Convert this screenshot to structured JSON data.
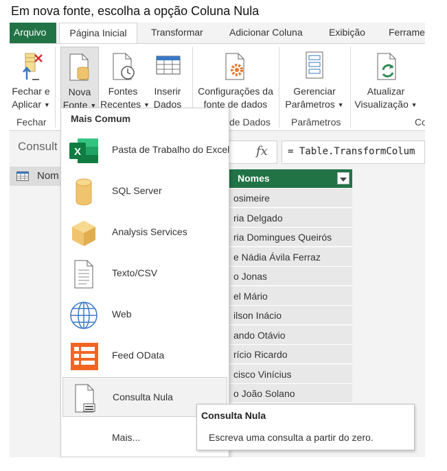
{
  "caption": "Em nova fonte, escolha a opção Coluna Nula",
  "tabs": {
    "arquivo": "Arquivo",
    "pagina_inicial": "Página Inicial",
    "transformar": "Transformar",
    "adicionar_coluna": "Adicionar Coluna",
    "exibicao": "Exibição",
    "ferramentas": "Ferrame"
  },
  "ribbon": {
    "fechar_aplicar": [
      "Fechar e",
      "Aplicar"
    ],
    "nova_fonte": [
      "Nova",
      "Fonte"
    ],
    "fontes_recentes": [
      "Fontes",
      "Recentes"
    ],
    "inserir_dados": [
      "Inserir",
      "Dados"
    ],
    "configuracoes": [
      "Configurações da",
      "fonte de dados"
    ],
    "gerenciar": [
      "Gerenciar",
      "Parâmetros"
    ],
    "atualizar": [
      "Atualizar",
      "Visualização"
    ],
    "groups": {
      "fechar": "Fechar",
      "dados": "de Dados",
      "parametros": "Parâmetros",
      "co": "Co"
    }
  },
  "left_pane": {
    "title": "Consult",
    "query_name": "Nom"
  },
  "formula": {
    "fx": "fx",
    "text": "= Table.TransformColum"
  },
  "grid": {
    "column_header": "Nomes",
    "rows": [
      "osimeire",
      "ria Delgado",
      "ria Domingues Queirós",
      "e Nádia Ávila Ferraz",
      "o Jonas",
      "el Mário",
      "ilson Inácio",
      "ando Otávio",
      "rício Ricardo",
      "cisco Vinícius",
      "o João Solano"
    ]
  },
  "dropdown": {
    "header": "Mais Comum",
    "items": [
      {
        "label": "Pasta de Trabalho do Excel",
        "icon": "excel-icon"
      },
      {
        "label": "SQL Server",
        "icon": "database-icon"
      },
      {
        "label": "Analysis Services",
        "icon": "cube-icon"
      },
      {
        "label": "Texto/CSV",
        "icon": "document-icon"
      },
      {
        "label": "Web",
        "icon": "globe-icon"
      },
      {
        "label": "Feed OData",
        "icon": "odata-icon"
      },
      {
        "label": "Consulta Nula",
        "icon": "blank-query-icon"
      },
      {
        "label": "Mais...",
        "icon": ""
      }
    ]
  },
  "tooltip": {
    "title": "Consulta Nula",
    "description": "Escreva uma consulta a partir do zero."
  },
  "colors": {
    "accent": "#217346",
    "db_yellow": "#f0c46e",
    "odata_orange": "#f26522"
  }
}
